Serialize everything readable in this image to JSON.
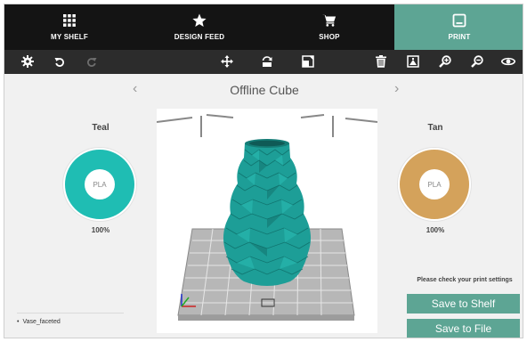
{
  "nav": {
    "tabs": [
      {
        "label": "MY SHELF",
        "icon": "grid-icon",
        "active": false
      },
      {
        "label": "DESIGN FEED",
        "icon": "star-icon",
        "active": false
      },
      {
        "label": "SHOP",
        "icon": "cart-icon",
        "active": false
      },
      {
        "label": "PRINT",
        "icon": "print-icon",
        "active": true
      }
    ]
  },
  "toolbar": {
    "left": [
      "gear-icon",
      "undo-icon",
      "redo-icon"
    ],
    "center": [
      "move-icon",
      "rotate-icon",
      "scale-icon"
    ],
    "right": [
      "trash-icon",
      "layout-icon",
      "zoom-in-icon",
      "zoom-out-icon",
      "eye-icon"
    ]
  },
  "model": {
    "title": "Offline Cube",
    "prev_arrow": "‹",
    "next_arrow": "›"
  },
  "colors": {
    "accent": "#5da594",
    "teal": "#1fbdb3",
    "tan": "#d4a25b",
    "nav": "#141414",
    "toolbar": "#2c2c2c",
    "vase": "#1d9e97"
  },
  "filaments": {
    "left": {
      "name": "Teal",
      "material": "PLA",
      "percent": "100%"
    },
    "right": {
      "name": "Tan",
      "material": "PLA",
      "percent": "100%"
    }
  },
  "files": [
    "Vase_faceted"
  ],
  "actions": {
    "check_text": "Please check your print settings",
    "save_shelf": "Save to Shelf",
    "save_file": "Save to File"
  }
}
